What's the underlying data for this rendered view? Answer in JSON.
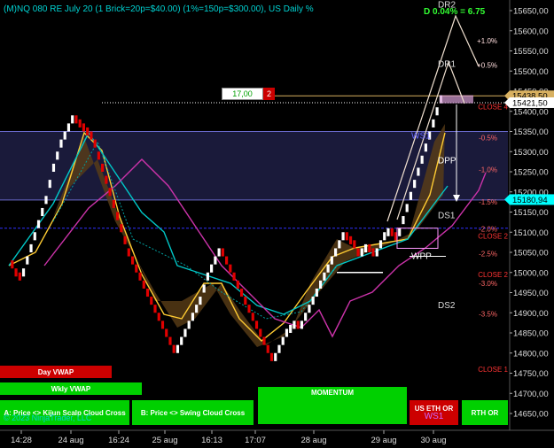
{
  "header": {
    "title": "(M)NQ 080 RE July 20 (1 Brick=20p=$40.00) (1%=150p=$300.00), US Daily %"
  },
  "chart_data": {
    "type": "renko",
    "ylim": [
      14600,
      15700
    ],
    "y_ticks": [
      "15650,00",
      "15600,00",
      "15550,00",
      "15500,00",
      "15450,00",
      "15400,00",
      "15350,00",
      "15300,00",
      "15250,00",
      "15200,00",
      "15150,00",
      "15100,00",
      "15050,00",
      "15000,00",
      "14950,00",
      "14900,00",
      "14850,00",
      "14800,00",
      "14750,00",
      "14700,00",
      "14650,00"
    ],
    "x_tick_labels": [
      "14:28",
      "24 aug",
      "16:24",
      "25 aug",
      "16:13",
      "17:07",
      "28 aug",
      "29 aug",
      "30 aug"
    ],
    "price_tags": [
      {
        "value": "15438,50",
        "price": 15438.5,
        "color": "#d8b060"
      },
      {
        "value": "15421,50",
        "price": 15421.5,
        "color": "#ffffff"
      },
      {
        "value": "15180,94",
        "price": 15180.94,
        "color": "#00ffff"
      }
    ],
    "pct_labels": [
      {
        "text": "+1.0%",
        "price": 15575
      },
      {
        "text": "+0.5%",
        "price": 15515
      },
      {
        "text": "-0.5%",
        "price": 15335
      },
      {
        "text": "-1.0%",
        "price": 15255
      },
      {
        "text": "-1.5%",
        "price": 15175
      },
      {
        "text": "-2.0%",
        "price": 15108
      },
      {
        "text": "-2.5%",
        "price": 15047
      },
      {
        "text": "-3.0%",
        "price": 14973
      },
      {
        "text": "-3.5%",
        "price": 14897
      }
    ],
    "levels": [
      {
        "name": "DR2",
        "price": 15667
      },
      {
        "name": "DR1",
        "price": 15519
      },
      {
        "name": "DPP",
        "price": 15280
      },
      {
        "name": "DS1",
        "price": 15143
      },
      {
        "name": "DS2",
        "price": 14920
      },
      {
        "name": "WPP",
        "price": 15042
      },
      {
        "name": "WS1",
        "price": 15341
      }
    ],
    "close_labels": [
      {
        "text": "CLOSE 4",
        "price": 15412
      },
      {
        "text": "CLOSE 2",
        "price": 15091
      },
      {
        "text": "CLOSE 2",
        "price": 14995
      },
      {
        "text": "CLOSE 1",
        "price": 14760
      }
    ],
    "daily_change": "D 0.04% = 6.75",
    "order_box": {
      "qty": "17,00",
      "count": "2"
    },
    "renko_path": [
      15030,
      15010,
      15000,
      14990,
      15010,
      15040,
      15070,
      15100,
      15130,
      15160,
      15190,
      15230,
      15270,
      15300,
      15330,
      15350,
      15370,
      15390,
      15380,
      15370,
      15360,
      15350,
      15330,
      15300,
      15270,
      15240,
      15210,
      15180,
      15150,
      15120,
      15090,
      15060,
      15040,
      15020,
      15000,
      14980,
      14960,
      14940,
      14920,
      14900,
      14880,
      14860,
      14840,
      14820,
      14800,
      14820,
      14840,
      14860,
      14880,
      14900,
      14920,
      14940,
      14970,
      15000,
      15020,
      15040,
      15060,
      15040,
      15020,
      15000,
      14980,
      14960,
      14940,
      14920,
      14900,
      14880,
      14860,
      14840,
      14820,
      14800,
      14780,
      14800,
      14820,
      14840,
      14860,
      14870,
      14880,
      14860,
      14880,
      14900,
      14920,
      14940,
      14960,
      14980,
      15000,
      15020,
      15040,
      15060,
      15080,
      15100,
      15090,
      15080,
      15060,
      15050,
      15060,
      15070,
      15060,
      15050,
      15060,
      15080,
      15100,
      15110,
      15100,
      15090,
      15110,
      15140,
      15170,
      15200,
      15230,
      15260,
      15290,
      15320,
      15350,
      15380,
      15410,
      15440
    ]
  },
  "legend_lines": [
    "Day VWAP",
    "Wkly VWAP"
  ],
  "buttons": {
    "kijun": "A: Price <> Kijun Scalp Cloud Cross",
    "swing": "B: Price <> Swing Cloud Cross",
    "momentum": "MOMENTUM",
    "us_eth_or": "US ETH OR",
    "ws1": "WS1",
    "rth_or": "RTH OR"
  },
  "copyright": "© 2023 NinjaTrader, LLC",
  "colors": {
    "up": "#ffffff",
    "down": "#e00000",
    "band": "#1a1a3a",
    "cyan": "#00c8c8",
    "gold": "#ffcc33",
    "magenta": "#cc33aa"
  }
}
